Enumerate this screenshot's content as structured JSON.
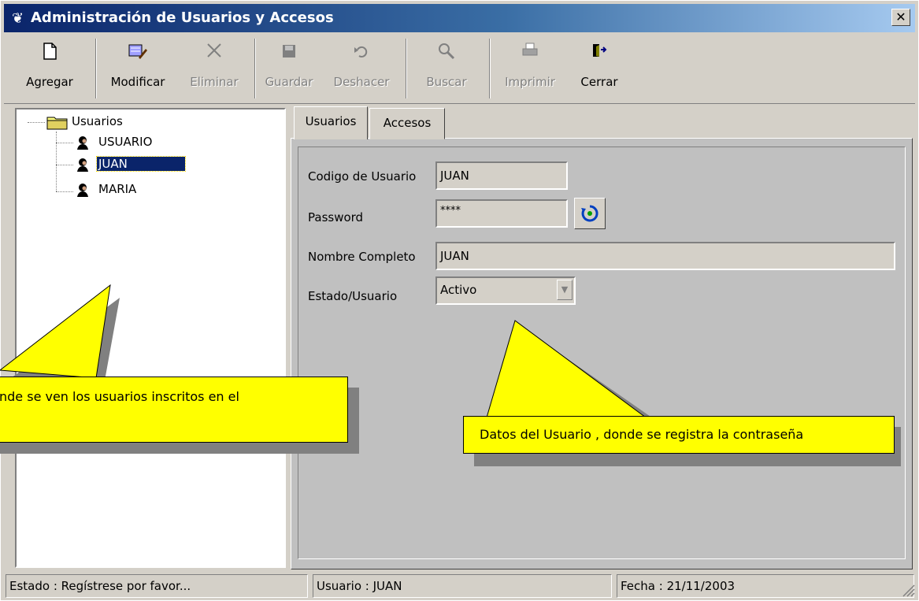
{
  "window": {
    "title": "Administración de Usuarios y Accesos",
    "close_label": "✕"
  },
  "toolbar": [
    {
      "label": "Agregar",
      "icon": "new-document-icon"
    },
    {
      "label": "Modificar",
      "icon": "edit-icon"
    },
    {
      "label": "Eliminar",
      "icon": "delete-icon"
    },
    {
      "label": "Guardar",
      "icon": "save-icon"
    },
    {
      "label": "Deshacer",
      "icon": "undo-icon"
    },
    {
      "label": "Buscar",
      "icon": "search-icon"
    },
    {
      "label": "Imprimir",
      "icon": "print-icon"
    },
    {
      "label": "Cerrar",
      "icon": "exit-door-icon"
    }
  ],
  "tree": {
    "root": "Usuarios",
    "children": [
      "USUARIO",
      "JUAN",
      "MARIA"
    ],
    "selected": "JUAN"
  },
  "tabs": [
    {
      "label": "Usuarios"
    },
    {
      "label": "Accesos"
    }
  ],
  "form": {
    "codigo_label": "Codigo de Usuario",
    "codigo_value": "JUAN",
    "password_label": "Password",
    "password_value": "****",
    "nombre_label": "Nombre Completo",
    "nombre_value": "JUAN",
    "estado_label": "Estado/Usuario",
    "estado_value": "Activo"
  },
  "callouts": {
    "left": "nde se ven los usuarios inscritos en el",
    "right": "Datos del Usuario , donde se registra la contraseña"
  },
  "statusbar": {
    "estado": "Estado  : Regístrese por favor...",
    "usuario": "Usuario : JUAN",
    "fecha": "Fecha   : 21/11/2003"
  },
  "colors": {
    "titlebar": "#0a246a",
    "callout": "#ffff00",
    "selection": "#0a246a"
  }
}
